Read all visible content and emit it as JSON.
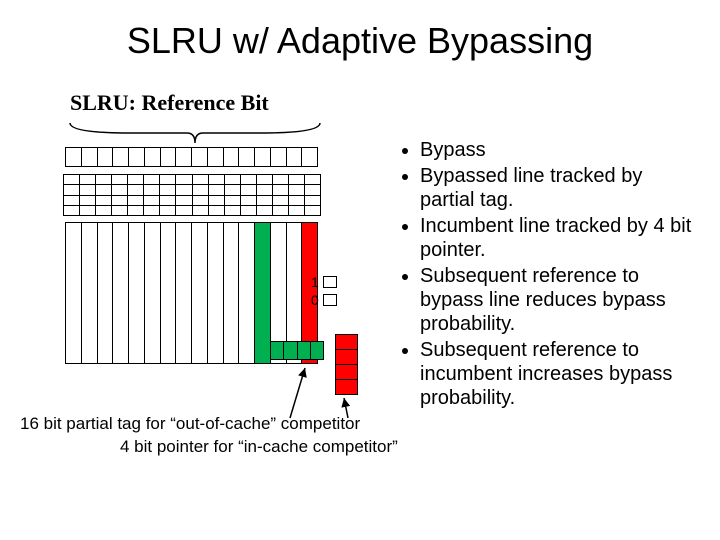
{
  "title": "SLRU w/ Adaptive Bypassing",
  "subtitle": "SLRU:  Reference Bit",
  "legend": {
    "one": "1",
    "zero": "0"
  },
  "bullets": [
    "Bypass",
    "Bypassed line tracked by partial tag.",
    "Incumbent line tracked by 4 bit pointer.",
    "Subsequent reference to bypass line reduces bypass probability.",
    "Subsequent reference to incumbent increases bypass probability."
  ],
  "anno_partial_tag": "16 bit partial tag for “out-of-cache” competitor",
  "anno_pointer": "4 bit pointer for “in-cache competitor”",
  "columns": {
    "total": 16,
    "green_index": 12,
    "red_index": 15,
    "tag_subdiv": 4
  }
}
